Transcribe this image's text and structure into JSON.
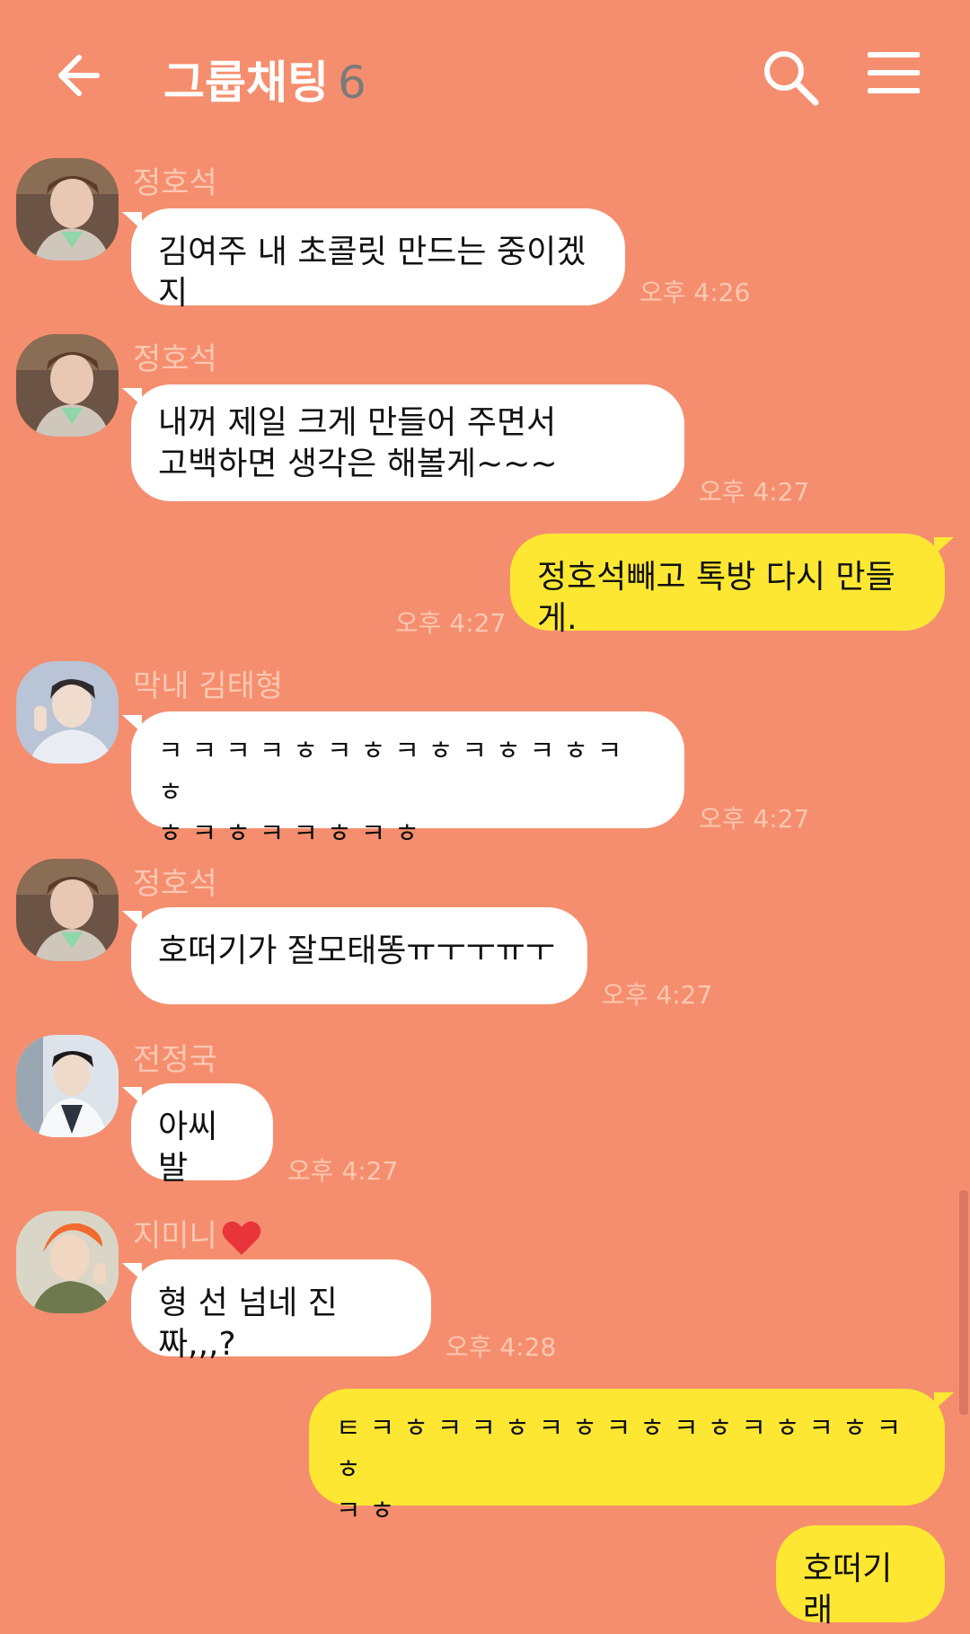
{
  "header": {
    "title": "그룹채팅",
    "member_count": "6"
  },
  "messages": [
    {
      "sender": "정호석",
      "text": "김여주 내 초콜릿 만드는 중이겠지",
      "time": "오후 4:26"
    },
    {
      "sender": "정호석",
      "text_line1": "내꺼 제일 크게 만들어 주면서",
      "text_line2": "고백하면 생각은 해볼게~~~",
      "time": "오후 4:27"
    },
    {
      "sender": "me",
      "text": "정호석빼고 톡방 다시 만들게.",
      "time": "오후 4:27"
    },
    {
      "sender": "막내 김태형",
      "text_line1": "ㅋㅋㅋㅋㅎㅋㅎㅋㅎㅋㅎㅋㅎㅋㅎ",
      "text_line2": "ㅎㅋㅎㅋㅋㅎㅋㅎ",
      "time": "오후 4:27"
    },
    {
      "sender": "정호석",
      "text": "호떠기가 잘모태똥ㅠㅜㅜㅠㅜ",
      "time": "오후 4:27"
    },
    {
      "sender": "전정국",
      "text": "아씨발",
      "time": "오후 4:27"
    },
    {
      "sender": "지미니",
      "text": "형 선 넘네 진짜,,,?",
      "time": "오후 4:28"
    },
    {
      "sender": "me",
      "text_line1": "ㅌㅋㅎㅋㅋㅎㅋㅎㅋㅎㅋㅎㅋㅎㅋㅎㅋㅎ",
      "text_line2": "ㅋㅎ"
    },
    {
      "sender": "me",
      "text": "호떠기래"
    }
  ],
  "colors": {
    "background": "#F58E6E",
    "my_bubble": "#FDE733",
    "other_bubble": "#FFFFFF",
    "meta_text": "#FBC8B3"
  },
  "icons": {
    "back": "back-arrow-icon",
    "search": "search-icon",
    "menu": "hamburger-menu-icon",
    "heart": "heart-icon"
  }
}
